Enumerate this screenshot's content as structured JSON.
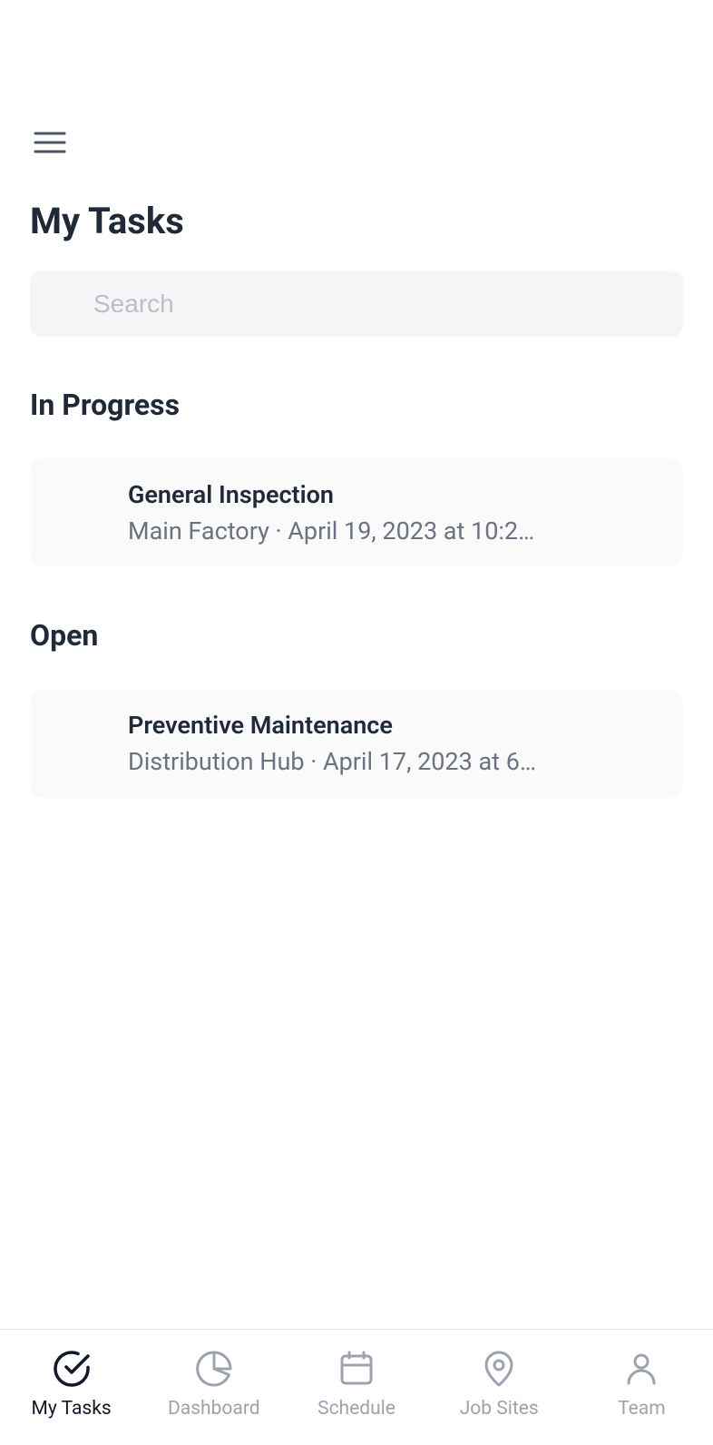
{
  "header": {
    "title": "My Tasks"
  },
  "search": {
    "placeholder": "Search",
    "value": ""
  },
  "sections": {
    "in_progress": {
      "title": "In Progress",
      "tasks": [
        {
          "title": "General Inspection",
          "subtitle": "Main Factory · April 19, 2023 at 10:2…"
        }
      ]
    },
    "open": {
      "title": "Open",
      "tasks": [
        {
          "title": "Preventive Maintenance",
          "subtitle": "Distribution Hub · April 17, 2023 at 6…"
        }
      ]
    }
  },
  "nav": {
    "items": [
      {
        "label": "My Tasks",
        "icon": "check-circle",
        "active": true
      },
      {
        "label": "Dashboard",
        "icon": "pie-chart",
        "active": false
      },
      {
        "label": "Schedule",
        "icon": "calendar",
        "active": false
      },
      {
        "label": "Job Sites",
        "icon": "map-pin",
        "active": false
      },
      {
        "label": "Team",
        "icon": "user",
        "active": false
      }
    ]
  }
}
